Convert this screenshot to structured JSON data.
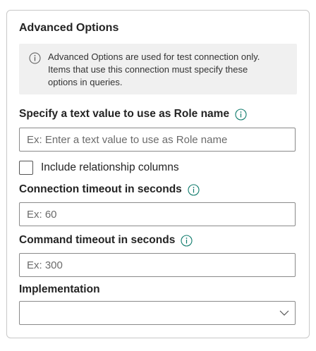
{
  "panel": {
    "title": "Advanced Options",
    "info": {
      "icon": "info-icon",
      "line1": "Advanced Options are used for test connection only.",
      "line2": "Items that use this connection must specify these",
      "line3": "options in queries."
    },
    "role_name": {
      "label": "Specify a text value to use as Role name",
      "placeholder": "Ex: Enter a text value to use as Role name",
      "value": ""
    },
    "relationship": {
      "label": "Include relationship columns",
      "checked": false
    },
    "connection_timeout": {
      "label": "Connection timeout in seconds",
      "placeholder": "Ex: 60",
      "value": ""
    },
    "command_timeout": {
      "label": "Command timeout in seconds",
      "placeholder": "Ex: 300",
      "value": ""
    },
    "implementation": {
      "label": "Implementation",
      "selected": ""
    }
  },
  "colors": {
    "help_icon": "#0f7b6c",
    "info_bg": "#f0f0f0",
    "border": "#8a8a8a"
  }
}
